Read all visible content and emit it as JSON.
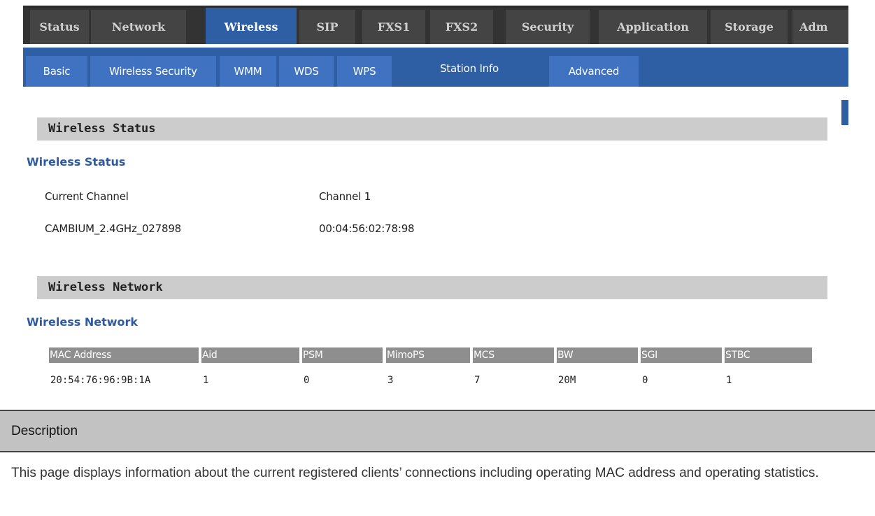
{
  "top_tabs": [
    "Status",
    "Network",
    "Wireless",
    "SIP",
    "FXS1",
    "FXS2",
    "Security",
    "Application",
    "Storage",
    "Adm"
  ],
  "sub_tabs": [
    "Basic",
    "Wireless Security",
    "WMM",
    "WDS",
    "WPS",
    "Station Info",
    "Advanced"
  ],
  "wireless_status": {
    "section_title": "Wireless Status",
    "subtitle": "Wireless Status",
    "rows": [
      {
        "label": "Current Channel",
        "value": "Channel 1"
      },
      {
        "label": "CAMBIUM_2.4GHz_027898",
        "value": "00:04:56:02:78:98"
      }
    ]
  },
  "wireless_network": {
    "section_title": "Wireless Network",
    "subtitle": "Wireless Network",
    "columns": [
      "MAC Address",
      "Aid",
      "PSM",
      "MimoPS",
      "MCS",
      "BW",
      "SGI",
      "STBC"
    ],
    "rows": [
      [
        "20:54:76:96:9B:1A",
        "1",
        "0",
        "3",
        "7",
        "20M",
        "0",
        "1"
      ]
    ]
  },
  "description": {
    "heading": "Description",
    "text": "This page displays information about the current registered clients’ connections including operating MAC address and operating statistics."
  }
}
